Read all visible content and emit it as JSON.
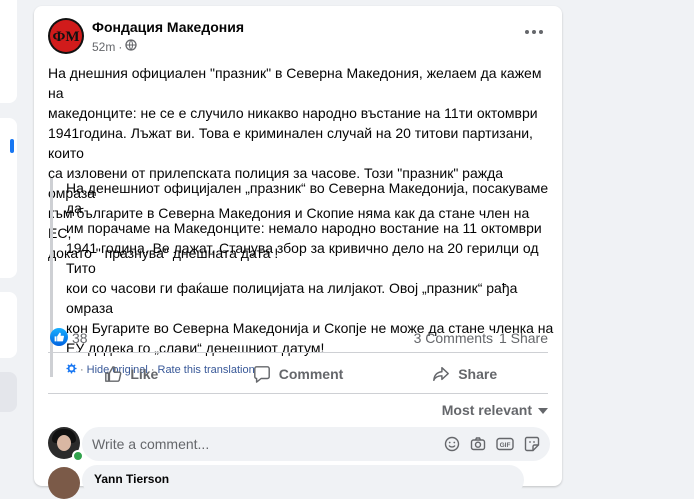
{
  "post": {
    "page_name": "Фондация Македония",
    "time": "52m",
    "logo_text": "ФМ",
    "text": "На днешния официален \"празник\" в Северна Македония, желаем да кажем на\nмакедонците: не се е случило никакво народно въстание на 11ти октомври\n1941година. Лъжат ви. Това е криминален случай на 20 титови партизани, които\nса изловени от прилепската полиция за часове. Този \"празник\" ражда омраза\nкъм българите в Северна Македония и Скопие няма как да стане член на ЕС,\nдокато \" празнува\" днешната дата !",
    "translation": {
      "text": "На денешниот официјален „празник“ во Северна Македонија, посакуваме да\nим порачаме на Македонците: немало народно востание на 11 октомври\n1941 година. Ве лажат. Станува збор за кривично дело на 20 герилци од Тито\nкои со часови ги фаќаше полицијата на лилјакот. Овој „празник“ рађа омраза\nкон Бугарите во Северна Македонија и Скопје не може да стане членка на\nЕУ додека го „слави“ денешниот датум!",
      "hide_label": "Hide original",
      "separator": "·",
      "rate_label": "Rate this translation"
    },
    "reactions_count": "38",
    "comments_count": "3 Comments",
    "shares_count": "1 Share"
  },
  "actions": {
    "like": "Like",
    "comment": "Comment",
    "share": "Share"
  },
  "comments": {
    "sort_label": "Most relevant",
    "input_placeholder": "Write a comment...",
    "first_commenter": "Yann Tierson"
  },
  "colors": {
    "accent": "#1877f2",
    "logo_red": "#d11b1b",
    "secondary_text": "#65676b",
    "online": "#31a24c"
  }
}
